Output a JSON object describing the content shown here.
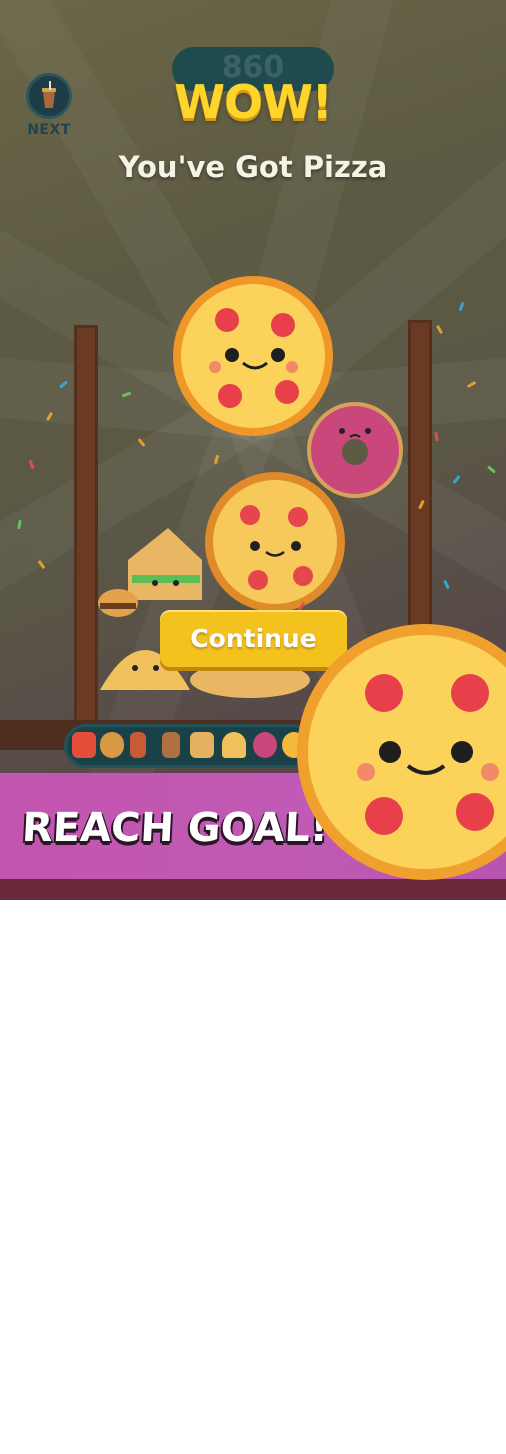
{
  "header": {
    "next_label": "NEXT",
    "next_icon": "drink-cup-icon",
    "score": "860",
    "wow": "WOW!",
    "subtitle": "You've Got Pizza"
  },
  "popup": {
    "continue_label": "Continue"
  },
  "banner": {
    "text": "REACH GOAL!"
  },
  "tray_items": [
    "fries",
    "burger",
    "hotdog",
    "drink",
    "sandwich",
    "taco",
    "donut",
    "pizza"
  ],
  "colors": {
    "wow": "#ffd52b",
    "continue": "#f4c21f",
    "banner": "#c354b0",
    "pizza_crust": "#f29a2e",
    "pizza_cheese": "#fbd25a",
    "pepperoni": "#e8404a"
  }
}
